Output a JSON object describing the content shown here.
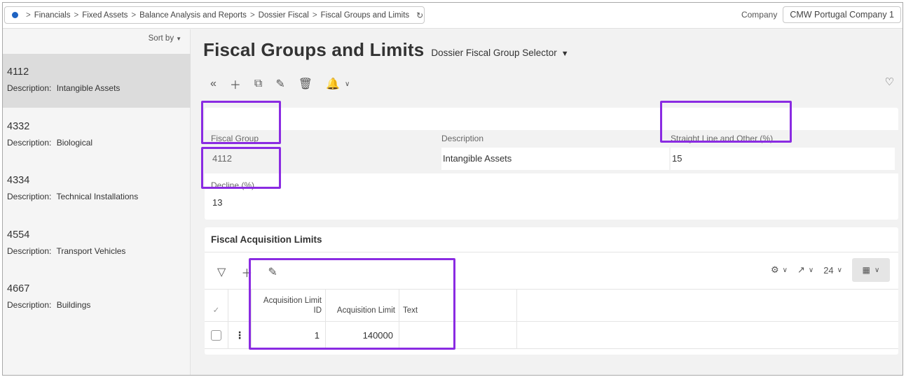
{
  "breadcrumb": {
    "items": [
      "Financials",
      "Fixed Assets",
      "Balance Analysis and Reports",
      "Dossier Fiscal",
      "Fiscal Groups and Limits"
    ],
    "separator": ">"
  },
  "company": {
    "label": "Company",
    "value": "CMW Portugal Company 1"
  },
  "list": {
    "sort_label": "Sort by",
    "items": [
      {
        "code": "4112",
        "desc_label": "Description:",
        "desc": "Intangible Assets",
        "selected": true
      },
      {
        "code": "4332",
        "desc_label": "Description:",
        "desc": "Biological"
      },
      {
        "code": "4334",
        "desc_label": "Description:",
        "desc": "Technical Installations"
      },
      {
        "code": "4554",
        "desc_label": "Description:",
        "desc": "Transport Vehicles"
      },
      {
        "code": "4667",
        "desc_label": "Description:",
        "desc": "Buildings"
      }
    ]
  },
  "page": {
    "title": "Fiscal Groups and Limits",
    "selector": "Dossier Fiscal Group Selector"
  },
  "header_fields": {
    "fiscal_group": {
      "label": "Fiscal Group",
      "value": "4112"
    },
    "description": {
      "label": "Description",
      "value": "Intangible Assets"
    },
    "straight_line": {
      "label": "Straight Line and Other (%)",
      "value": "15"
    },
    "decline": {
      "label": "Decline (%)",
      "value": "13"
    }
  },
  "limits": {
    "title": "Fiscal Acquisition Limits",
    "page_size": "24",
    "columns": [
      "Acquisition Limit ID",
      "Acquisition Limit",
      "Text"
    ],
    "rows": [
      {
        "id": "1",
        "limit": "140000",
        "text": ""
      }
    ]
  },
  "colors": {
    "highlight": "#8a2be2",
    "brand_dot": "#1f63c2"
  }
}
